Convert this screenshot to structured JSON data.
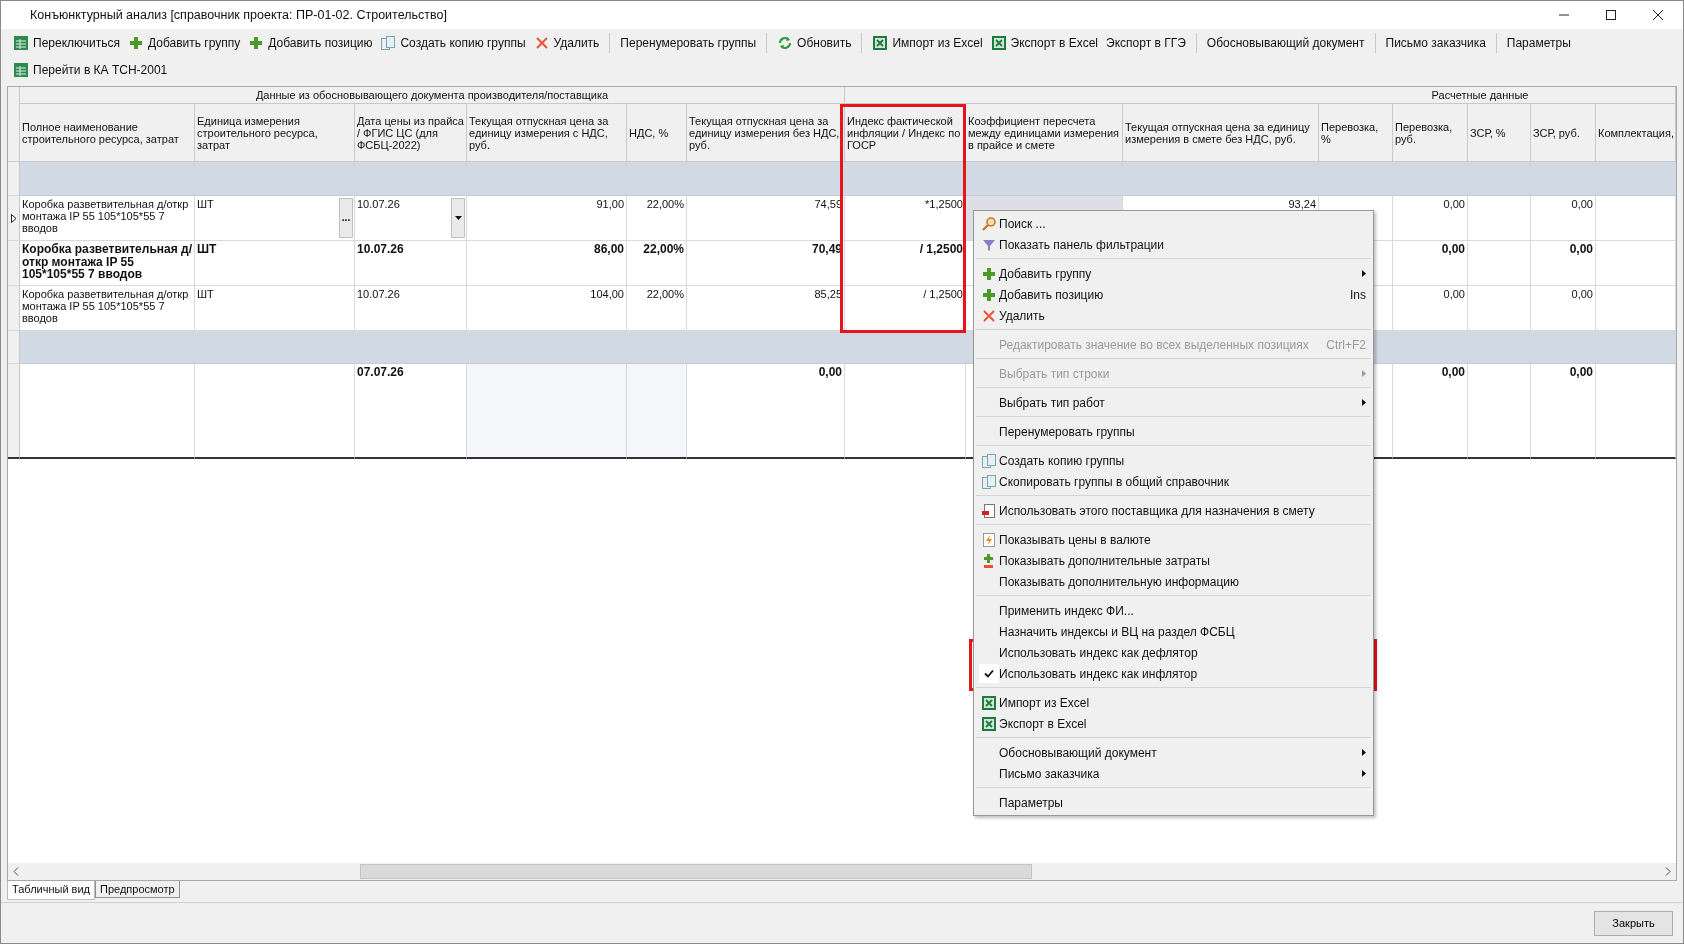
{
  "window": {
    "title": "Конъюнктурный анализ [справочник проекта: ПР-01-02. Строительство]"
  },
  "toolbar_rows": [
    {
      "items": [
        {
          "kind": "button",
          "label": "Переключиться"
        },
        {
          "kind": "button",
          "label": "Добавить группу"
        },
        {
          "kind": "button",
          "label": "Добавить позицию"
        },
        {
          "kind": "button",
          "label": "Создать копию группы"
        },
        {
          "kind": "button",
          "label": "Удалить"
        },
        {
          "kind": "separator"
        },
        {
          "kind": "button",
          "label": "Перенумеровать группы"
        },
        {
          "kind": "separator"
        },
        {
          "kind": "button",
          "label": "Обновить"
        },
        {
          "kind": "separator"
        },
        {
          "kind": "button",
          "label": "Импорт из Excel"
        },
        {
          "kind": "button",
          "label": "Экспорт в Excel"
        },
        {
          "kind": "button",
          "label": "Экспорт в ГГЭ"
        },
        {
          "kind": "separator"
        },
        {
          "kind": "button",
          "label": "Обосновывающий документ"
        },
        {
          "kind": "separator"
        },
        {
          "kind": "button",
          "label": "Письмо заказчика"
        },
        {
          "kind": "separator"
        },
        {
          "kind": "button",
          "label": "Параметры"
        }
      ]
    },
    {
      "items": [
        {
          "kind": "button",
          "label": "Перейти в КА ТСН-2001"
        }
      ]
    }
  ],
  "table": {
    "groups": [
      "Данные из обосновывающего документа производителя/поставщика",
      "Расчетные данные"
    ],
    "columns": [
      "Полное наименование строительного ресурса, затрат",
      "Единица измерения строительного ресурса, затрат",
      "Дата цены из прайса / ФГИС ЦС (для ФСБЦ-2022)",
      "Текущая отпускная цена за единицу измерения с НДС, руб.",
      "НДС, %",
      "Текущая отпускная цена за единицу измерения без НДС, руб.",
      "Индекс фактической инфляции /  Индекс по  ГОСР",
      "Коэффициент пересчета между единицами измерения в прайсе и смете",
      "Текущая отпускная цена за единицу измерения в смете без НДС, руб.",
      "Перевозка, %",
      "Перевозка, руб.",
      "ЗСР, %",
      "ЗСР, руб.",
      "Комплектация,"
    ],
    "rows": [
      {
        "kind": "group"
      },
      {
        "kind": "item",
        "current": true,
        "bold": false,
        "editor": {
          "ellipsis": "..."
        },
        "cells": [
          "Коробка разветвительная д/откр монтажа IP 55 105*105*55 7 вводов",
          "ШТ",
          "10.07.26",
          "91,00",
          "22,00%",
          "74,59",
          "*1,2500",
          null,
          "93,24",
          null,
          "0,00",
          null,
          "0,00",
          null
        ]
      },
      {
        "kind": "item",
        "current": false,
        "bold": true,
        "cells": [
          "Коробка разветвительная д/откр монтажа IP 55 105*105*55 7 вводов",
          "ШТ",
          "10.07.26",
          "86,00",
          "22,00%",
          "70,49",
          "/ 1,2500",
          null,
          null,
          null,
          "0,00",
          null,
          "0,00",
          null
        ]
      },
      {
        "kind": "item",
        "current": false,
        "bold": false,
        "cells": [
          "Коробка разветвительная д/откр монтажа IP 55 105*105*55 7 вводов",
          "ШТ",
          "10.07.26",
          "104,00",
          "22,00%",
          "85,25",
          "/ 1,2500",
          null,
          null,
          null,
          "0,00",
          null,
          "0,00",
          null
        ]
      },
      {
        "kind": "group"
      },
      {
        "kind": "total",
        "bold": true,
        "cells": [
          null,
          null,
          "07.07.26",
          null,
          null,
          "0,00",
          null,
          null,
          null,
          null,
          "0,00",
          null,
          "0,00",
          null
        ]
      }
    ]
  },
  "menu": {
    "items": [
      {
        "kind": "item",
        "label": "Поиск ...",
        "disabled": false,
        "checked": false,
        "submenu": false
      },
      {
        "kind": "item",
        "label": "Показать панель фильтрации",
        "disabled": false,
        "checked": false,
        "submenu": false
      },
      {
        "kind": "separator"
      },
      {
        "kind": "item",
        "label": "Добавить группу",
        "disabled": false,
        "checked": false,
        "submenu": true
      },
      {
        "kind": "item",
        "label": "Добавить позицию",
        "shortcut": "Ins",
        "disabled": false,
        "checked": false,
        "submenu": false
      },
      {
        "kind": "item",
        "label": "Удалить",
        "disabled": false,
        "checked": false,
        "submenu": false
      },
      {
        "kind": "separator"
      },
      {
        "kind": "item",
        "label": "Редактировать значение во всех выделенных позициях",
        "shortcut": "Ctrl+F2",
        "disabled": true,
        "checked": false,
        "submenu": false
      },
      {
        "kind": "separator"
      },
      {
        "kind": "item",
        "label": "Выбрать тип строки",
        "disabled": true,
        "checked": false,
        "submenu": true
      },
      {
        "kind": "separator"
      },
      {
        "kind": "item",
        "label": "Выбрать тип работ",
        "disabled": false,
        "checked": false,
        "submenu": true
      },
      {
        "kind": "separator"
      },
      {
        "kind": "item",
        "label": "Перенумеровать группы",
        "disabled": false,
        "checked": false,
        "submenu": false
      },
      {
        "kind": "separator"
      },
      {
        "kind": "item",
        "label": "Создать копию группы",
        "disabled": false,
        "checked": false,
        "submenu": false
      },
      {
        "kind": "item",
        "label": "Скопировать группы в общий справочник",
        "disabled": false,
        "checked": false,
        "submenu": false
      },
      {
        "kind": "separator"
      },
      {
        "kind": "item",
        "label": "Использовать этого поставщика для назначения в смету",
        "disabled": false,
        "checked": false,
        "submenu": false
      },
      {
        "kind": "separator"
      },
      {
        "kind": "item",
        "label": "Показывать цены в валюте",
        "disabled": false,
        "checked": false,
        "submenu": false
      },
      {
        "kind": "item",
        "label": "Показывать дополнительные затраты",
        "disabled": false,
        "checked": false,
        "submenu": false
      },
      {
        "kind": "item",
        "label": "Показывать дополнительную информацию",
        "disabled": false,
        "checked": false,
        "submenu": false
      },
      {
        "kind": "separator"
      },
      {
        "kind": "item",
        "label": "Применить индекс ФИ...",
        "disabled": false,
        "checked": false,
        "submenu": false
      },
      {
        "kind": "item",
        "label": "Назначить индексы и ВЦ на раздел ФСБЦ",
        "disabled": false,
        "checked": false,
        "submenu": false
      },
      {
        "kind": "item",
        "label": "Использовать индекс как дефлятор",
        "disabled": false,
        "checked": false,
        "submenu": false
      },
      {
        "kind": "item",
        "label": "Использовать индекс как инфлятор",
        "disabled": false,
        "checked": true,
        "submenu": false
      },
      {
        "kind": "separator"
      },
      {
        "kind": "item",
        "label": "Импорт из Excel",
        "disabled": false,
        "checked": false,
        "submenu": false
      },
      {
        "kind": "item",
        "label": "Экспорт в Excel",
        "disabled": false,
        "checked": false,
        "submenu": false
      },
      {
        "kind": "separator"
      },
      {
        "kind": "item",
        "label": "Обосновывающий документ",
        "disabled": false,
        "checked": false,
        "submenu": true
      },
      {
        "kind": "item",
        "label": "Письмо заказчика",
        "disabled": false,
        "checked": false,
        "submenu": true
      },
      {
        "kind": "separator"
      },
      {
        "kind": "item",
        "label": "Параметры",
        "disabled": false,
        "checked": false,
        "submenu": false
      }
    ]
  },
  "bottom_tabs": [
    {
      "label": "Табличный вид",
      "selected": true
    },
    {
      "label": "Предпросмотр",
      "selected": false
    }
  ],
  "buttons": [
    "Закрыть"
  ]
}
